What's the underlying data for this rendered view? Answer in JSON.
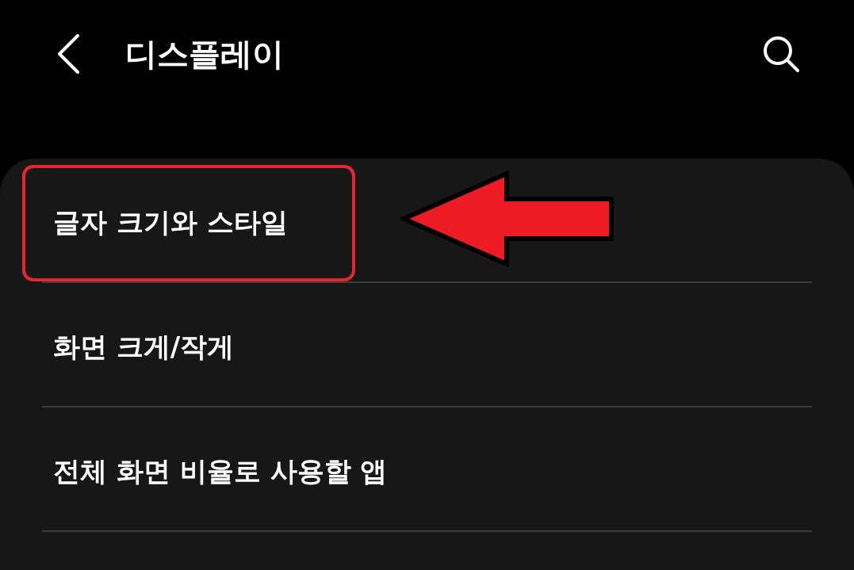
{
  "header": {
    "title": "디스플레이"
  },
  "items": [
    {
      "label": "글자 크기와 스타일",
      "highlighted": true
    },
    {
      "label": "화면 크게/작게",
      "highlighted": false
    },
    {
      "label": "전체 화면 비율로 사용할 앱",
      "highlighted": false
    }
  ]
}
